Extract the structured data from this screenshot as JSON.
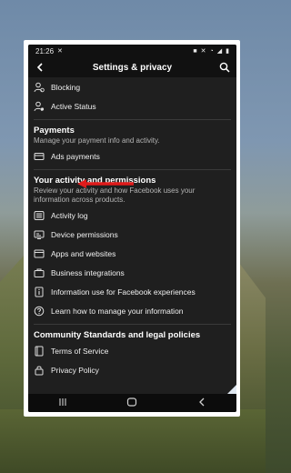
{
  "status": {
    "time": "21:26"
  },
  "header": {
    "title": "Settings & privacy"
  },
  "top_items": [
    {
      "label": "Blocking",
      "icon": "user-block-icon"
    },
    {
      "label": "Active Status",
      "icon": "user-status-icon"
    }
  ],
  "payments": {
    "title": "Payments",
    "description": "Manage your payment info and activity.",
    "items": [
      {
        "label": "Ads payments",
        "icon": "card-icon"
      }
    ]
  },
  "activity": {
    "title": "Your activity and permissions",
    "description_line1": "Review your activity and how Facebook uses your",
    "description_line2": "information across products.",
    "items": [
      {
        "label": "Activity log",
        "icon": "list-icon"
      },
      {
        "label": "Device permissions",
        "icon": "device-icon"
      },
      {
        "label": "Apps and websites",
        "icon": "apps-icon"
      },
      {
        "label": "Business integrations",
        "icon": "briefcase-icon"
      },
      {
        "label": "Information use for Facebook experiences",
        "icon": "info-doc-icon"
      },
      {
        "label": "Learn how to manage your information",
        "icon": "info-question-icon"
      }
    ]
  },
  "community": {
    "title": "Community Standards and legal policies",
    "items": [
      {
        "label": "Terms of Service",
        "icon": "book-icon"
      },
      {
        "label": "Privacy Policy",
        "icon": "lock-icon"
      }
    ]
  },
  "colors": {
    "annotation_arrow": "#e01b1b",
    "panel": "#1f1f1f"
  }
}
